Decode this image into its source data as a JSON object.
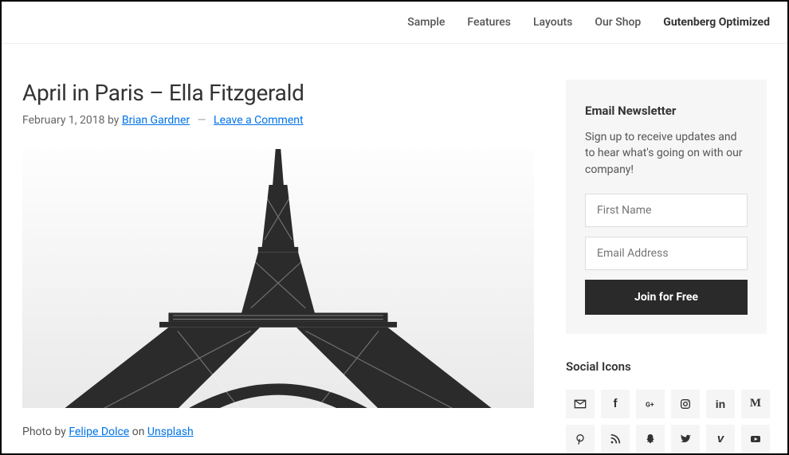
{
  "nav": {
    "items": [
      {
        "label": "Sample"
      },
      {
        "label": "Features"
      },
      {
        "label": "Layouts"
      },
      {
        "label": "Our Shop"
      },
      {
        "label": "Gutenberg Optimized"
      }
    ]
  },
  "post": {
    "title": "April in Paris – Ella Fitzgerald",
    "date": "February 1, 2018",
    "by": " by ",
    "author": "Brian Gardner",
    "comments": "Leave a Comment",
    "caption_prefix": "Photo by ",
    "caption_author": "Felipe Dolce",
    "caption_on": " on ",
    "caption_source": "Unsplash"
  },
  "newsletter": {
    "title": "Email Newsletter",
    "desc": "Sign up to receive updates and to hear what's going on with our company!",
    "firstname_placeholder": "First Name",
    "email_placeholder": "Email Address",
    "button": "Join for Free"
  },
  "social": {
    "title": "Social Icons"
  }
}
